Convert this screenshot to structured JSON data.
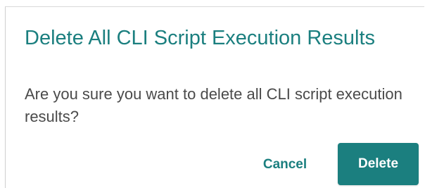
{
  "dialog": {
    "title": "Delete All CLI Script Execution Results",
    "message": "Are you sure you want to delete all CLI script execution results?",
    "cancel_label": "Cancel",
    "delete_label": "Delete"
  },
  "colors": {
    "accent": "#1b7f7f",
    "text": "#4a4a4a",
    "background": "#ffffff"
  }
}
